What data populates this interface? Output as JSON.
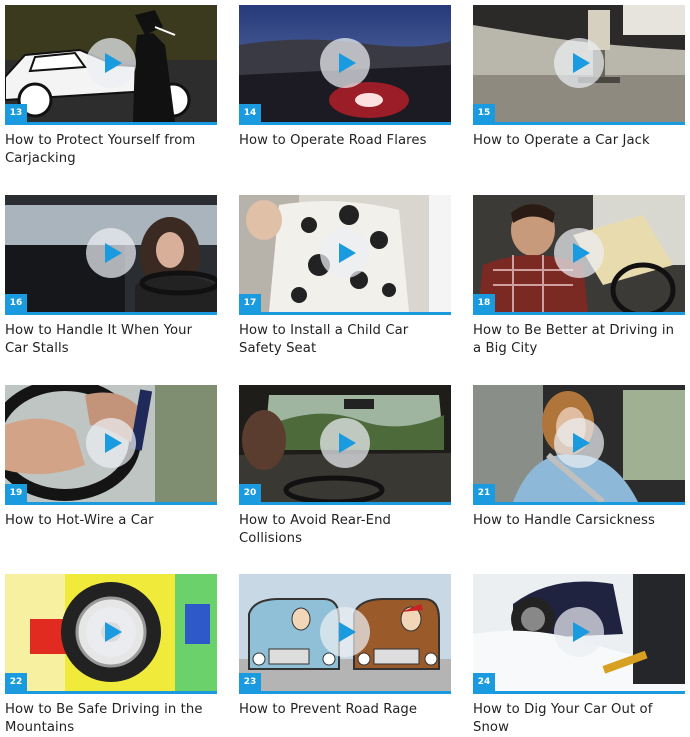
{
  "videos": [
    {
      "number": "13",
      "title": "How to Protect Yourself from Carjacking",
      "scene": "cartoon-carjack"
    },
    {
      "number": "14",
      "title": "How to Operate Road Flares",
      "scene": "road-flare"
    },
    {
      "number": "15",
      "title": "How to Operate a Car Jack",
      "scene": "car-jack"
    },
    {
      "number": "16",
      "title": "How to Handle It When Your Car Stalls",
      "scene": "car-interior-woman"
    },
    {
      "number": "17",
      "title": "How to Install a Child Car Safety Seat",
      "scene": "child-seat"
    },
    {
      "number": "18",
      "title": "How to Be Better at Driving in a Big City",
      "scene": "man-with-map"
    },
    {
      "number": "19",
      "title": "How to Hot-Wire a Car",
      "scene": "hot-wire"
    },
    {
      "number": "20",
      "title": "How to Avoid Rear-End Collisions",
      "scene": "windshield-road"
    },
    {
      "number": "21",
      "title": "How to Handle Carsickness",
      "scene": "woman-seatbelt"
    },
    {
      "number": "22",
      "title": "How to Be Safe Driving in the Mountains",
      "scene": "cartoon-tire"
    },
    {
      "number": "23",
      "title": "How to Prevent Road Rage",
      "scene": "cartoon-cars"
    },
    {
      "number": "24",
      "title": "How to Dig Your Car Out of Snow",
      "scene": "snow-dig"
    }
  ],
  "colors": {
    "accent": "#1a9be0",
    "play_icon": "#1a9be0"
  },
  "icons": {
    "play": "play-icon"
  }
}
